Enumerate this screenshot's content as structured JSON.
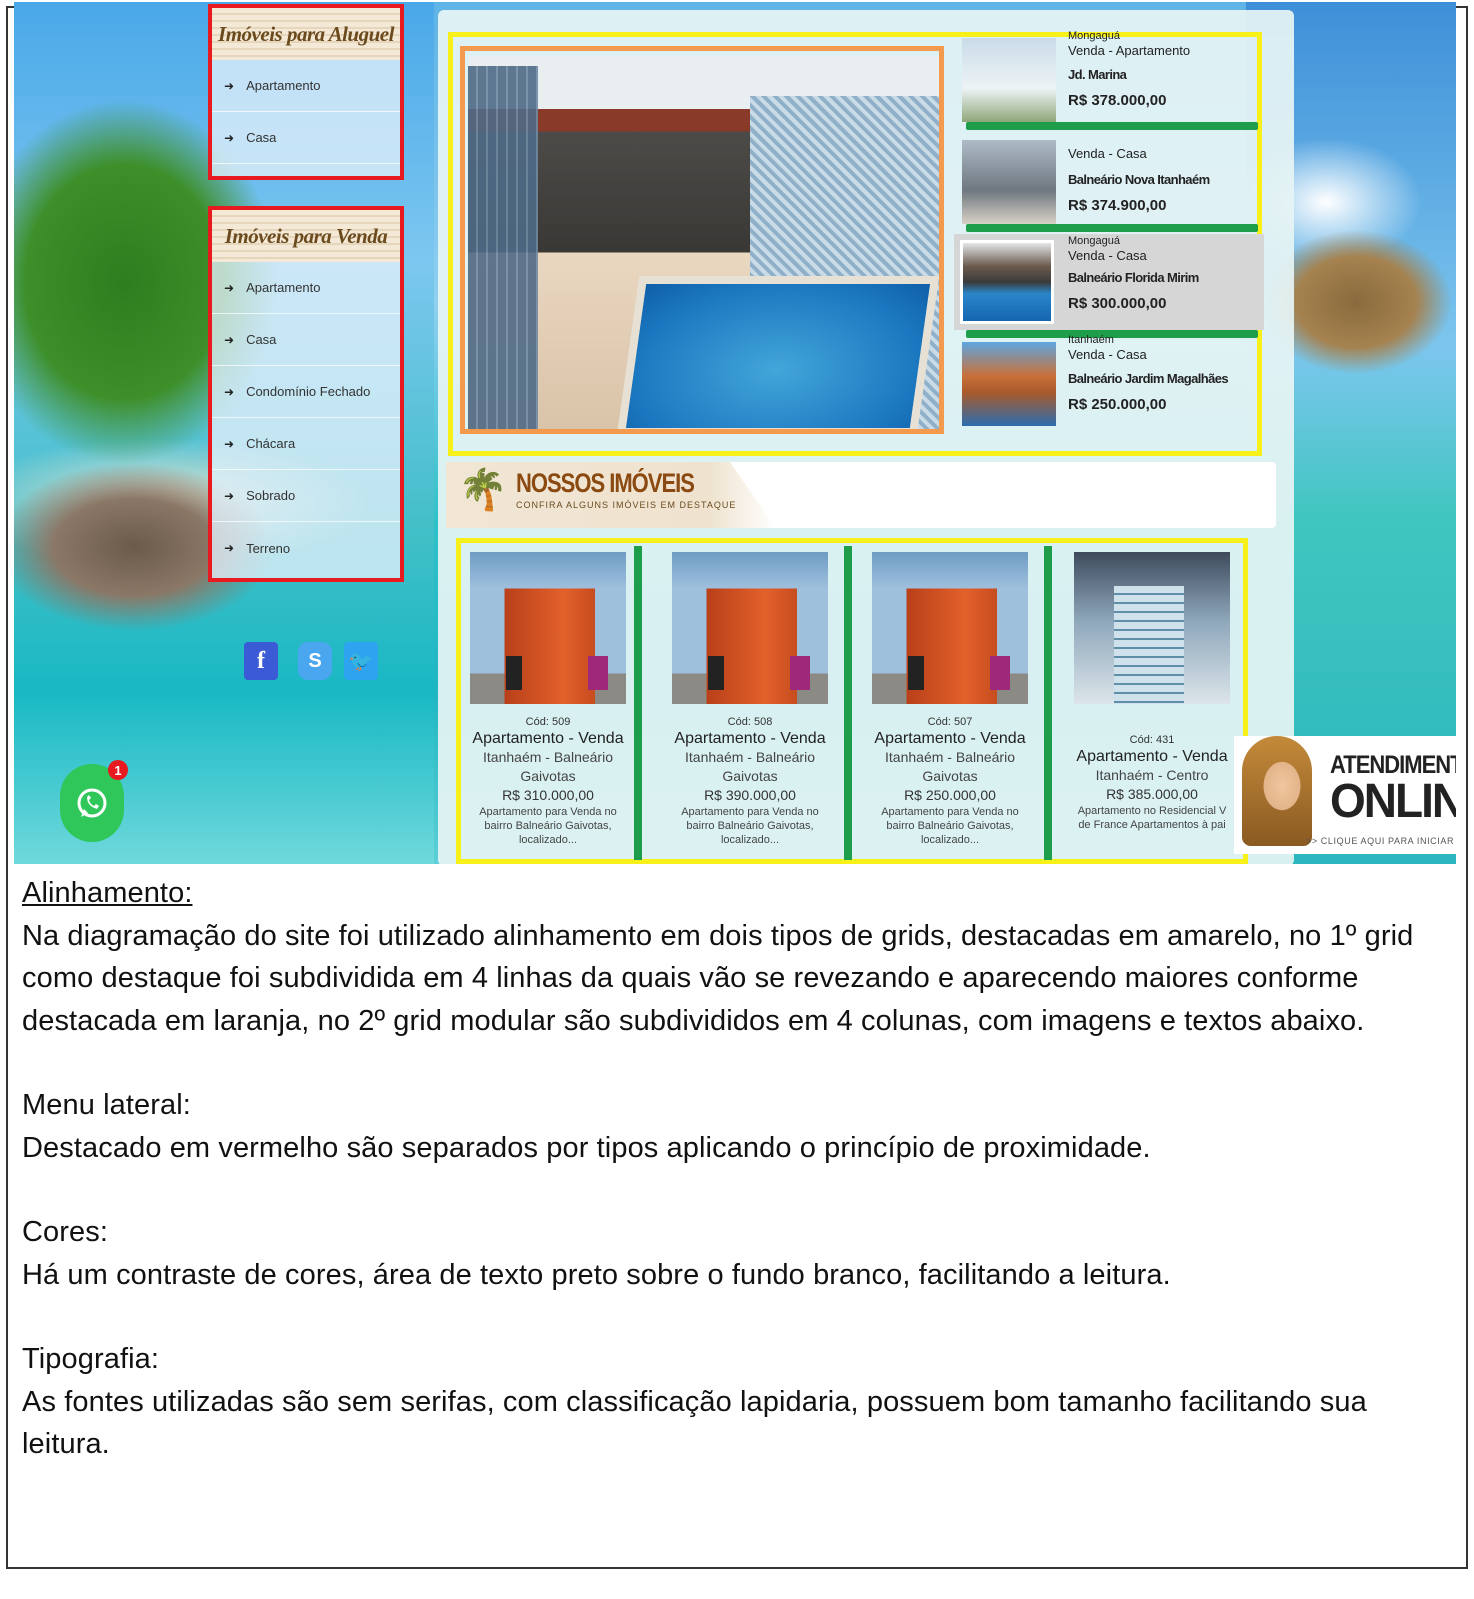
{
  "menu_rent": {
    "title": "Imóveis para Aluguel",
    "items": [
      "Apartamento",
      "Casa"
    ]
  },
  "menu_sale": {
    "title": "Imóveis para Venda",
    "items": [
      "Apartamento",
      "Casa",
      "Condomínio Fechado",
      "Chácara",
      "Sobrado",
      "Terreno"
    ]
  },
  "social": {
    "facebook": "f",
    "skype": "S",
    "twitter": "🐦"
  },
  "whatsapp": {
    "badge": "1"
  },
  "featured_list": [
    {
      "city": "Mongaguá",
      "type": "Venda - Apartamento",
      "location": "Jd. Marina",
      "price": "R$ 378.000,00"
    },
    {
      "city": "",
      "type": "Venda - Casa",
      "location": "Balneário Nova Itanhaém",
      "price": "R$ 374.900,00"
    },
    {
      "city": "Mongaguá",
      "type": "Venda - Casa",
      "location": "Balneário Florida Mirim",
      "price": "R$ 300.000,00"
    },
    {
      "city": "Itanhaém",
      "type": "Venda - Casa",
      "location": "Balneário Jardim Magalhães",
      "price": "R$ 250.000,00"
    }
  ],
  "nossos": {
    "title": "NOSSOS IMÓVEIS",
    "subtitle": "CONFIRA ALGUNS IMÓVEIS EM DESTAQUE"
  },
  "cards": [
    {
      "cod": "Cód: 509",
      "type": "Apartamento - Venda",
      "loc1": "Itanhaém - Balneário",
      "loc2": "Gaivotas",
      "price": "R$ 310.000,00",
      "desc1": "Apartamento para Venda no",
      "desc2": "bairro Balneário Gaivotas,",
      "desc3": "localizado..."
    },
    {
      "cod": "Cód: 508",
      "type": "Apartamento - Venda",
      "loc1": "Itanhaém - Balneário",
      "loc2": "Gaivotas",
      "price": "R$ 390.000,00",
      "desc1": "Apartamento para Venda no",
      "desc2": "bairro Balneário Gaivotas,",
      "desc3": "localizado..."
    },
    {
      "cod": "Cód: 507",
      "type": "Apartamento - Venda",
      "loc1": "Itanhaém - Balneário",
      "loc2": "Gaivotas",
      "price": "R$ 250.000,00",
      "desc1": "Apartamento para Venda no",
      "desc2": "bairro Balneário Gaivotas,",
      "desc3": "localizado..."
    },
    {
      "cod": "Cód: 431",
      "type": "Apartamento - Venda",
      "loc1": "Itanhaém - Centro",
      "loc2": "",
      "price": "R$ 385.000,00",
      "desc1": "Apartamento no Residencial V",
      "desc2": "de France Apartamentos à pai",
      "desc3": ""
    }
  ],
  "atendimento": {
    "line1": "ATENDIMENTO",
    "line2": "ONLINE",
    "line3": ">> CLIQUE AQUI PARA INICIAR"
  },
  "notes": {
    "h1": "Alinhamento:",
    "p1": "Na diagramação do site foi utilizado alinhamento em dois tipos de grids, destacadas em amarelo, no 1º grid como destaque foi subdividida em 4 linhas da quais vão se revezando e aparecendo maiores conforme destacada em laranja, no 2º grid modular são subdivididos em 4 colunas, com imagens e textos abaixo.",
    "h2": "Menu lateral:",
    "p2": "Destacado em vermelho são separados por tipos aplicando o princípio de proximidade.",
    "h3": "Cores:",
    "p3": "Há um contraste de cores, área de texto preto sobre o fundo branco, facilitando a leitura.",
    "h4": "Tipografia:",
    "p4": "As fontes utilizadas são sem serifas, com classificação lapidaria, possuem bom tamanho facilitando sua leitura."
  },
  "colors": {
    "grid_highlight": "#f7f119",
    "hero_highlight": "#f39a4f",
    "menu_highlight": "#e8191f",
    "divider_green": "#1e9e4a"
  }
}
